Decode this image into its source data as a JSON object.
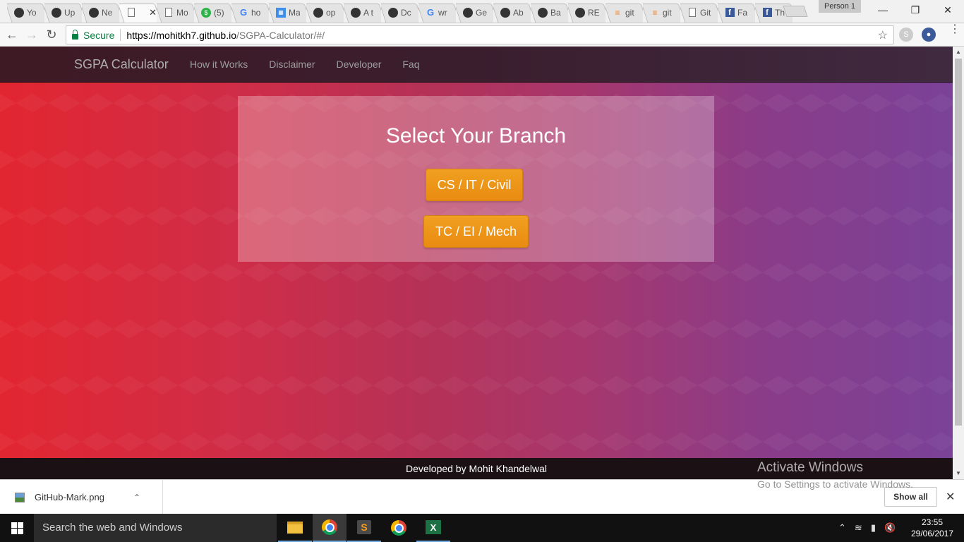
{
  "browser": {
    "tabs": [
      {
        "icon": "github-icon",
        "title": "Yo"
      },
      {
        "icon": "github-icon",
        "title": "Up"
      },
      {
        "icon": "github-icon",
        "title": "Ne"
      },
      {
        "icon": "page-icon",
        "title": "",
        "active": true
      },
      {
        "icon": "page-icon",
        "title": "Mo"
      },
      {
        "icon": "dollar-icon",
        "title": "(5)"
      },
      {
        "icon": "google-icon",
        "title": "ho"
      },
      {
        "icon": "calendar-icon",
        "title": "Ma"
      },
      {
        "icon": "github-icon",
        "title": "op"
      },
      {
        "icon": "github-icon",
        "title": "A t"
      },
      {
        "icon": "github-icon",
        "title": "Dc"
      },
      {
        "icon": "google-icon",
        "title": "wr"
      },
      {
        "icon": "github-icon",
        "title": "Ge"
      },
      {
        "icon": "github-icon",
        "title": "Ab"
      },
      {
        "icon": "github-icon",
        "title": "Ba"
      },
      {
        "icon": "github-icon",
        "title": "RE"
      },
      {
        "icon": "stackoverflow-icon",
        "title": "git"
      },
      {
        "icon": "stackoverflow-icon",
        "title": "git"
      },
      {
        "icon": "page-icon",
        "title": "Git"
      },
      {
        "icon": "facebook-icon",
        "title": "Fa"
      },
      {
        "icon": "facebook-icon",
        "title": "Th"
      }
    ],
    "profile": "Person 1",
    "secure_label": "Secure",
    "url_host": "https://mohitkh7.github.io",
    "url_path": "/SGPA-Calculator/#/"
  },
  "site": {
    "brand": "SGPA Calculator",
    "nav": [
      "How it Works",
      "Disclaimer",
      "Developer",
      "Faq"
    ],
    "panel_title": "Select Your Branch",
    "buttons": {
      "branch1": "CS / IT / Civil",
      "branch2": "TC / EI / Mech"
    },
    "footer": "Developed by Mohit Khandelwal",
    "colors": {
      "button": "#ec951a",
      "gradient_left": "#e22630",
      "gradient_right": "#7a4298"
    }
  },
  "watermark": {
    "line1": "Activate Windows",
    "line2": "Go to Settings to activate Windows."
  },
  "downloads": {
    "file": "GitHub-Mark.png",
    "show_all": "Show all"
  },
  "taskbar": {
    "search_placeholder": "Search the web and Windows",
    "time": "23:55",
    "date": "29/06/2017"
  }
}
